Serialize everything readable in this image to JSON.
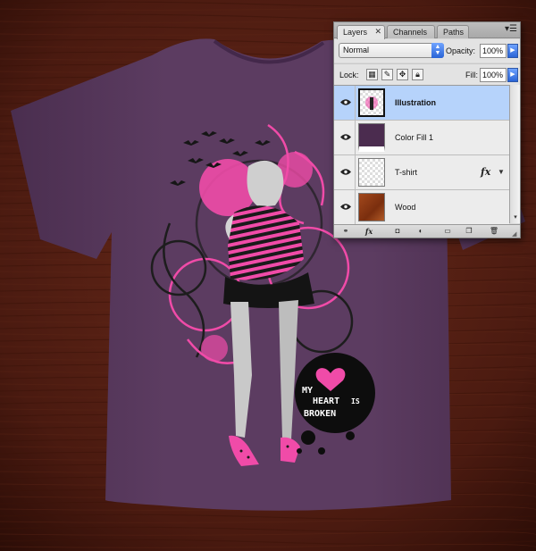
{
  "panel": {
    "tabs": [
      {
        "label": "Layers",
        "close": "✕",
        "active": true
      },
      {
        "label": "Channels",
        "active": false
      },
      {
        "label": "Paths",
        "active": false
      }
    ],
    "menu_icon": "panel-menu-icon",
    "blend_mode": "Normal",
    "opacity_label": "Opacity:",
    "opacity_value": "100%",
    "lock_label": "Lock:",
    "fill_label": "Fill:",
    "fill_value": "100%"
  },
  "layers": [
    {
      "name": "Illustration",
      "selected": true,
      "thumb": "illustration-thumbnail",
      "visible": true
    },
    {
      "name": "Color Fill 1",
      "selected": false,
      "thumb": "color-fill-thumbnail",
      "visible": true
    },
    {
      "name": "T-shirt",
      "selected": false,
      "thumb": "transparent-thumbnail",
      "fx": "fx",
      "visible": true
    },
    {
      "name": "Wood",
      "selected": false,
      "thumb": "wood-thumbnail",
      "visible": true
    }
  ],
  "footer_icons": [
    "link-layers-icon",
    "fx-icon",
    "layer-mask-icon",
    "adjustment-layer-icon",
    "new-group-icon",
    "new-layer-icon",
    "trash-icon"
  ],
  "artwork": {
    "badge_text_lines": [
      "MY",
      "HEART",
      "IS",
      "BROKEN"
    ]
  },
  "colors": {
    "shirt": "#5a3a5e",
    "wood": "#4a1a10",
    "pink": "#f04ba8",
    "selection": "#b6d3fb",
    "color_fill": "#4b2c4f"
  }
}
